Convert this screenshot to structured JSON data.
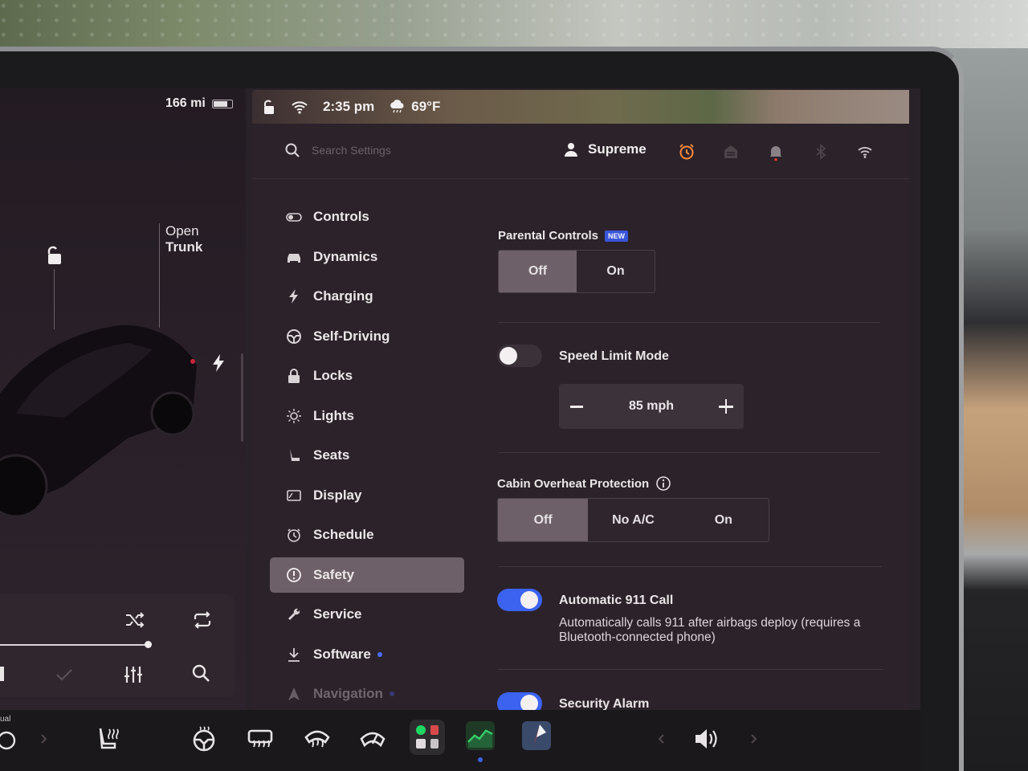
{
  "car": {
    "range": "166 mi",
    "trunk_line1": "Open",
    "trunk_line2": "Trunk"
  },
  "status_bar": {
    "time": "2:35 pm",
    "temperature": "69°F"
  },
  "header": {
    "search_placeholder": "Search Settings",
    "user_name": "Supreme"
  },
  "menu": {
    "items": [
      {
        "label": "Controls",
        "icon": "toggle-icon"
      },
      {
        "label": "Dynamics",
        "icon": "car-front-icon"
      },
      {
        "label": "Charging",
        "icon": "bolt-icon"
      },
      {
        "label": "Self-Driving",
        "icon": "steering-wheel-icon"
      },
      {
        "label": "Locks",
        "icon": "lock-icon"
      },
      {
        "label": "Lights",
        "icon": "sun-icon"
      },
      {
        "label": "Seats",
        "icon": "seat-icon"
      },
      {
        "label": "Display",
        "icon": "display-icon"
      },
      {
        "label": "Schedule",
        "icon": "clock-icon"
      },
      {
        "label": "Safety",
        "icon": "alert-circle-icon"
      },
      {
        "label": "Service",
        "icon": "wrench-icon"
      },
      {
        "label": "Software",
        "icon": "download-icon"
      },
      {
        "label": "Navigation",
        "icon": "navigation-icon"
      }
    ],
    "active": "Safety"
  },
  "content": {
    "parental_controls": {
      "label": "Parental Controls",
      "badge": "NEW",
      "options": [
        "Off",
        "On"
      ],
      "selected": "Off"
    },
    "speed_limit": {
      "label": "Speed Limit Mode",
      "enabled": false,
      "value": "85 mph",
      "minus": "−",
      "plus": "+"
    },
    "cabin_overheat": {
      "label": "Cabin Overheat Protection",
      "options": [
        "Off",
        "No A/C",
        "On"
      ],
      "selected": "Off"
    },
    "auto_911": {
      "label": "Automatic 911 Call",
      "enabled": true,
      "description_line1": "Automatically calls 911 after airbags deploy (requires a",
      "description_line2": "Bluetooth-connected phone)"
    },
    "security_alarm": {
      "label": "Security Alarm",
      "enabled": true
    }
  },
  "dock": {
    "gear_label": "ual"
  },
  "colors": {
    "accent_blue": "#3b63f0",
    "alarm_orange": "#ff8a3d",
    "notification_red": "#ff3b3b",
    "selected_segment": "#6e6068"
  }
}
